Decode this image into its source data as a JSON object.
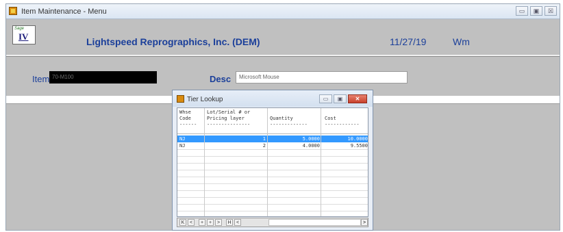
{
  "window": {
    "title": "Item Maintenance - Menu",
    "controls": [
      "▭",
      "▣",
      "☒"
    ]
  },
  "header": {
    "logo_top": "Sage",
    "logo_num": "IV",
    "company": "Lightspeed Reprographics, Inc. (DEM)",
    "date": "11/27/19",
    "user": "Wm"
  },
  "form": {
    "item_label": "Item",
    "item_value": "70-M100",
    "desc_label": "Desc",
    "desc_value": "Microsoft Mouse"
  },
  "lookup": {
    "title": "Tier Lookup",
    "controls": {
      "minimize": "▭",
      "maximize": "▣",
      "close": "✕"
    },
    "columns": [
      "Whse\nCode\n------",
      "Lot/Serial # or\nPricing layer\n---------------",
      "\nQuantity\n-------------",
      "\nCost\n------------"
    ],
    "rows": [
      {
        "whse": "NJ",
        "layer": "1",
        "quantity": "5.0000",
        "cost": "10.0000"
      },
      {
        "whse": "NJ",
        "layer": "2",
        "quantity": "4.0000",
        "cost": "9.5500"
      }
    ],
    "nav": [
      "K",
      "<",
      "+",
      "+",
      ">",
      "H",
      "<"
    ],
    "scroll_right": ">"
  },
  "colors": {
    "label_blue": "#1b3f9a",
    "selection": "#3399ff",
    "bg_gray": "#c0c0c0"
  }
}
